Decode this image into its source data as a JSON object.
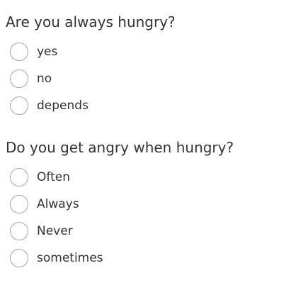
{
  "questions": [
    {
      "title": "Are you always hungry?",
      "options": [
        "yes",
        "no",
        "depends"
      ]
    },
    {
      "title": "Do you get angry when hungry?",
      "options": [
        "Often",
        "Always",
        "Never",
        "sometimes"
      ]
    }
  ],
  "colors": {
    "text": "#333333",
    "radio_border": "#a6a6a6",
    "background": "#ffffff"
  }
}
